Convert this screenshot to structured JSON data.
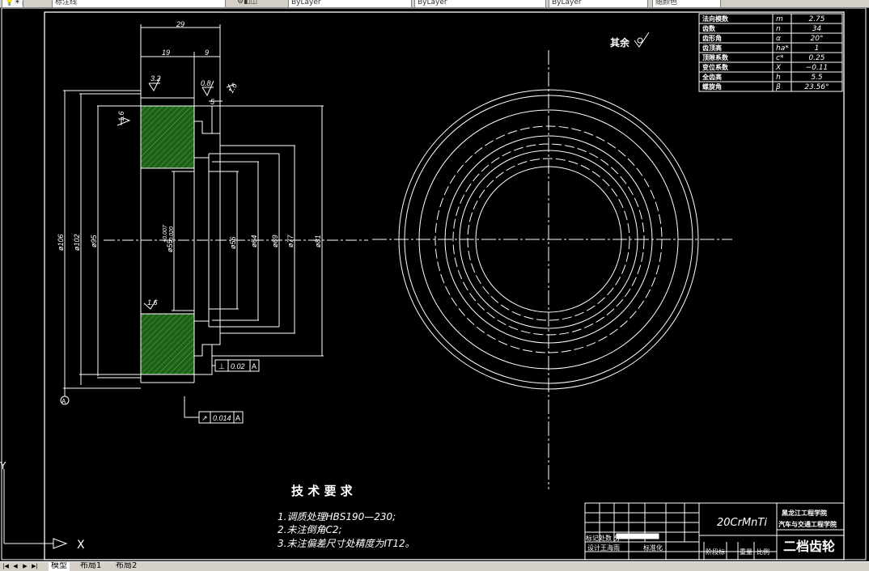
{
  "toolbar": {
    "layer_name": "标注线",
    "color_value": "ByLayer",
    "linetype_value": "ByLayer",
    "lineweight_value": "ByLayer",
    "plotstyle_value": "随颜色"
  },
  "drawing": {
    "dims": {
      "d29": "29",
      "d19": "19",
      "d9": "9",
      "d5": "5",
      "r32": "3.2",
      "r08": "0.8",
      "r16a": "1.6",
      "r16b": "1.6",
      "r16c": "1.6",
      "phi106": "ø106",
      "phi102": "ø102",
      "phi95": "ø95",
      "phi55": "ø55",
      "tol_up": "+0.007",
      "tol_dn": "-0.020",
      "phi56": "ø56",
      "phi64": "ø64",
      "phi69": "ø69",
      "phi77": "ø77",
      "phi81": "ø81"
    },
    "datum": "A",
    "perp_tol": {
      "symbol": "⊥",
      "value": "0.02",
      "datum": "A"
    },
    "runout_tol": {
      "symbol": "↗",
      "value": "0.014",
      "datum": "A"
    },
    "rest_roughness": "其余",
    "tech_title": "技 术 要 求",
    "tech_notes": [
      "1.调质处理HBS190—230;",
      "2.未注倒角C2;",
      "3.未注偏差尺寸处精度为IT12。"
    ],
    "param_table": [
      [
        "法向模数",
        "m",
        "2.75"
      ],
      [
        "齿数",
        "n",
        "34"
      ],
      [
        "齿形角",
        "α",
        "20°"
      ],
      [
        "齿顶高",
        "ha*",
        "1"
      ],
      [
        "顶隙系数",
        "c*",
        "0.25"
      ],
      [
        "变位系数",
        "X",
        "−0.11"
      ],
      [
        "全齿高",
        "h",
        "5.5"
      ],
      [
        "螺旋角",
        "β",
        "23.56°"
      ]
    ],
    "title_block": {
      "material": "20CrMnTi",
      "school1": "黑龙江工程学院",
      "school2": "汽车与交通工程学院",
      "part_name": "二档齿轮",
      "c_mark": "标记处数 分",
      "c_design": "设计王海雨",
      "c_std": "标准化",
      "c_stage": "阶段标",
      "c_weight": "重量",
      "c_scale": "比例"
    },
    "ucs": {
      "x": "X",
      "y": "Y"
    }
  },
  "statusbar": {
    "nav": [
      "|◀",
      "◀",
      "▶",
      "▶|"
    ],
    "tabs": [
      "模型",
      "布局1",
      "布局2"
    ]
  },
  "colors": {
    "background": "#000000",
    "lines": "#ffffff",
    "hatch": "#1f5f1a",
    "hatch_lines": "#3ec23a",
    "chrome": "#d4d0c8"
  }
}
